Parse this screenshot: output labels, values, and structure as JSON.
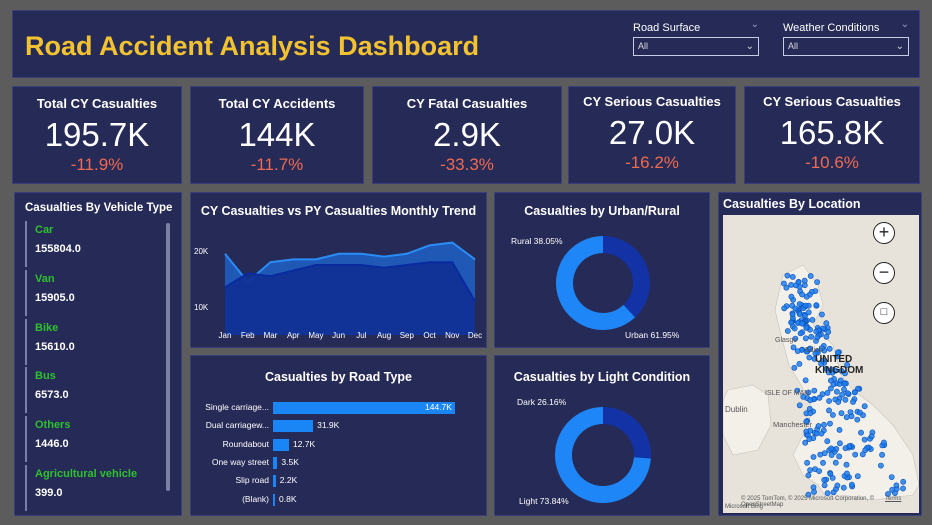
{
  "header": {
    "title": "Road Accident Analysis Dashboard",
    "slicers": [
      {
        "label": "Road Surface",
        "value": "All"
      },
      {
        "label": "Weather Conditions",
        "value": "All"
      }
    ]
  },
  "kpis": [
    {
      "title": "Total CY Casualties",
      "value": "195.7K",
      "change": "-11.9%"
    },
    {
      "title": "Total CY Accidents",
      "value": "144K",
      "change": "-11.7%"
    },
    {
      "title": "CY Fatal Casualties",
      "value": "2.9K",
      "change": "-33.3%"
    },
    {
      "title": "CY Serious Casualties",
      "value": "27.0K",
      "change": "-16.2%"
    },
    {
      "title": "CY Serious Casualties",
      "value": "165.8K",
      "change": "-10.6%"
    }
  ],
  "vehicle": {
    "title": "Casualties By Vehicle Type",
    "items": [
      {
        "name": "Car",
        "value": "155804.0"
      },
      {
        "name": "Van",
        "value": "15905.0"
      },
      {
        "name": "Bike",
        "value": "15610.0"
      },
      {
        "name": "Bus",
        "value": "6573.0"
      },
      {
        "name": "Others",
        "value": "1446.0"
      },
      {
        "name": "Agricultural vehicle",
        "value": "399.0"
      }
    ]
  },
  "trend": {
    "title": "CY Casualties vs PY Casualties Monthly Trend",
    "yticks": [
      "20K",
      "10K"
    ]
  },
  "road_type": {
    "title": "Casualties by Road Type"
  },
  "urban": {
    "title": "Casualties by Urban/Rural",
    "labels": [
      "Rural 38.05%",
      "Urban 61.95%"
    ]
  },
  "light": {
    "title": "Casualties by Light Condition",
    "labels": [
      "Dark 26.16%",
      "Light 73.84%"
    ]
  },
  "location": {
    "title": "Casualties By Location",
    "map_labels": {
      "uk": "UNITED KINGDOM",
      "glasgow": "Glasgo",
      "edinburgh": "Edinb",
      "isle_of_man": "ISLE OF MAN",
      "dublin": "Dublin",
      "manchester": "Manchester",
      "attribution": "© 2025 TomTom, © 2025 Microsoft Corporation, © OpenStreetMap",
      "terms": "Terms",
      "bing": "Microsoft Bing"
    },
    "zoom_in": "+",
    "zoom_out": "−"
  },
  "chart_data": [
    {
      "type": "area",
      "title": "CY Casualties vs PY Casualties Monthly Trend",
      "x": [
        "Jan",
        "Feb",
        "Mar",
        "Apr",
        "May",
        "Jun",
        "Jul",
        "Aug",
        "Sep",
        "Oct",
        "Nov",
        "Dec"
      ],
      "yticks": [
        "20K",
        "10K"
      ],
      "series": [
        {
          "values": [
            19500,
            14500,
            18000,
            18500,
            18500,
            19500,
            19500,
            19000,
            19500,
            21000,
            21500,
            18500
          ]
        },
        {
          "values": [
            13500,
            16000,
            15500,
            16500,
            17500,
            17500,
            17500,
            17000,
            17500,
            18000,
            18000,
            11000
          ]
        }
      ]
    },
    {
      "type": "bar",
      "title": "Casualties by Road Type",
      "categories": [
        "Single carriage...",
        "Dual carriagew...",
        "Roundabout",
        "One way street",
        "Slip road",
        "(Blank)"
      ],
      "values": [
        144.7,
        31.9,
        12.7,
        3.5,
        2.2,
        0.8
      ],
      "labels": [
        "144.7K",
        "31.9K",
        "12.7K",
        "3.5K",
        "2.2K",
        "0.8K"
      ]
    },
    {
      "type": "pie",
      "title": "Casualties by Urban/Rural",
      "categories": [
        "Rural",
        "Urban"
      ],
      "values": [
        38.05,
        61.95
      ]
    },
    {
      "type": "pie",
      "title": "Casualties by Light Condition",
      "categories": [
        "Dark",
        "Light"
      ],
      "values": [
        26.16,
        73.84
      ]
    }
  ],
  "colors": {
    "title": "#f2c231",
    "negative": "#f06a4f",
    "green": "#2ec02e",
    "accent": "#1a86f5",
    "dark_accent": "#1b3a9e",
    "panel": "#262a57"
  }
}
